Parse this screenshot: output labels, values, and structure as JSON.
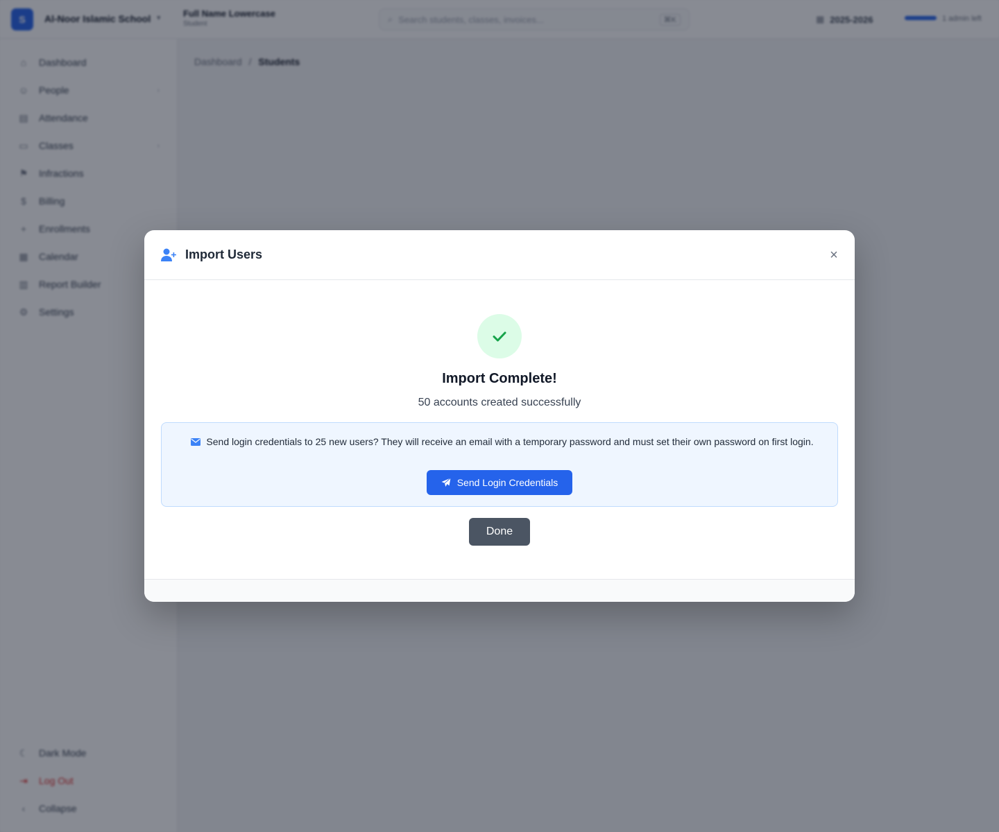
{
  "app": {
    "logo_letter": "S",
    "school_name": "Al-Noor Islamic School",
    "page_title": "Full Name Lowercase",
    "page_subtitle": "Student",
    "search_placeholder": "Search students, classes, invoices...",
    "search_shortcut": "⌘K",
    "academic_year": "2025-2026",
    "user_label": "1 admin left"
  },
  "sidebar": {
    "items": [
      {
        "label": "Dashboard",
        "icon": "home-icon"
      },
      {
        "label": "People",
        "icon": "users-icon"
      },
      {
        "label": "Attendance",
        "icon": "clipboard-icon"
      },
      {
        "label": "Classes",
        "icon": "book-icon"
      },
      {
        "label": "Infractions",
        "icon": "flag-icon"
      },
      {
        "label": "Billing",
        "icon": "money-icon"
      },
      {
        "label": "Enrollments",
        "icon": "user-plus-icon"
      },
      {
        "label": "Calendar",
        "icon": "calendar-icon"
      },
      {
        "label": "Report Builder",
        "icon": "report-icon"
      },
      {
        "label": "Settings",
        "icon": "gear-icon"
      }
    ],
    "bottom": {
      "dark_mode": "Dark Mode",
      "log_out": "Log Out",
      "collapse": "Collapse"
    }
  },
  "breadcrumb": {
    "root": "Dashboard",
    "separator": "/",
    "current": "Students"
  },
  "modal": {
    "title": "Import Users",
    "close_glyph": "×",
    "success_title": "Import Complete!",
    "success_subtitle": "50 accounts created successfully",
    "info_text": "Send login credentials to 25 new users? They will receive an email with a temporary password and must set their own password on first login.",
    "send_button": "Send Login Credentials",
    "done_button": "Done"
  },
  "colors": {
    "primary": "#2563eb",
    "success_bg": "#dcfce7",
    "success_check": "#16a34a",
    "info_bg": "#eff6ff",
    "info_border": "#bfdbfe",
    "done_button": "#4b5563"
  }
}
